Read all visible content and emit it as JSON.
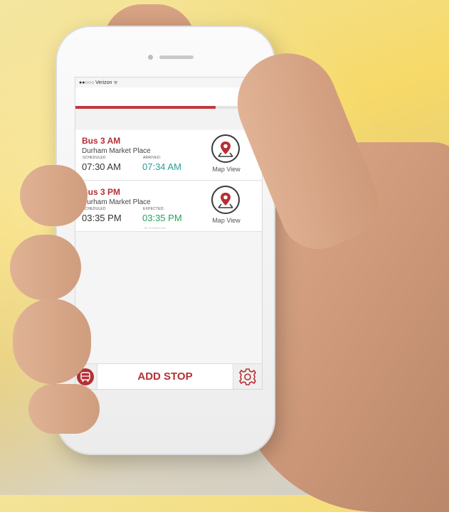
{
  "status_bar": {
    "carrier": "Verizon"
  },
  "progress": {
    "fraction": 0.75
  },
  "colors": {
    "accent": "#b52f35",
    "arrived": "#2a9c97",
    "expected": "#27a35a"
  },
  "arrivals": [
    {
      "title": "Bus 3 AM",
      "place": "Durham Market Place",
      "scheduled_label": "SCHEDULED",
      "scheduled_time": "07:30 AM",
      "actual_label": "ARRIVED:",
      "actual_time": "07:34 AM",
      "note": "",
      "map_label": "Map View",
      "map_icon": "map-pin-icon"
    },
    {
      "title": "Bus 3 PM",
      "place": "Durham Market Place",
      "scheduled_label": "SCHEDULED",
      "scheduled_time": "03:35 PM",
      "actual_label": "EXPECTED:",
      "actual_time": "03:35 PM",
      "note": "AS SCHEDULED",
      "map_label": "Map View",
      "map_icon": "map-pin-icon"
    }
  ],
  "bottom_bar": {
    "add_stop_label": "ADD STOP",
    "left_icon": "bus-icon",
    "right_icon": "gear-icon"
  },
  "top_bar": {
    "icon": "chat-icon"
  }
}
